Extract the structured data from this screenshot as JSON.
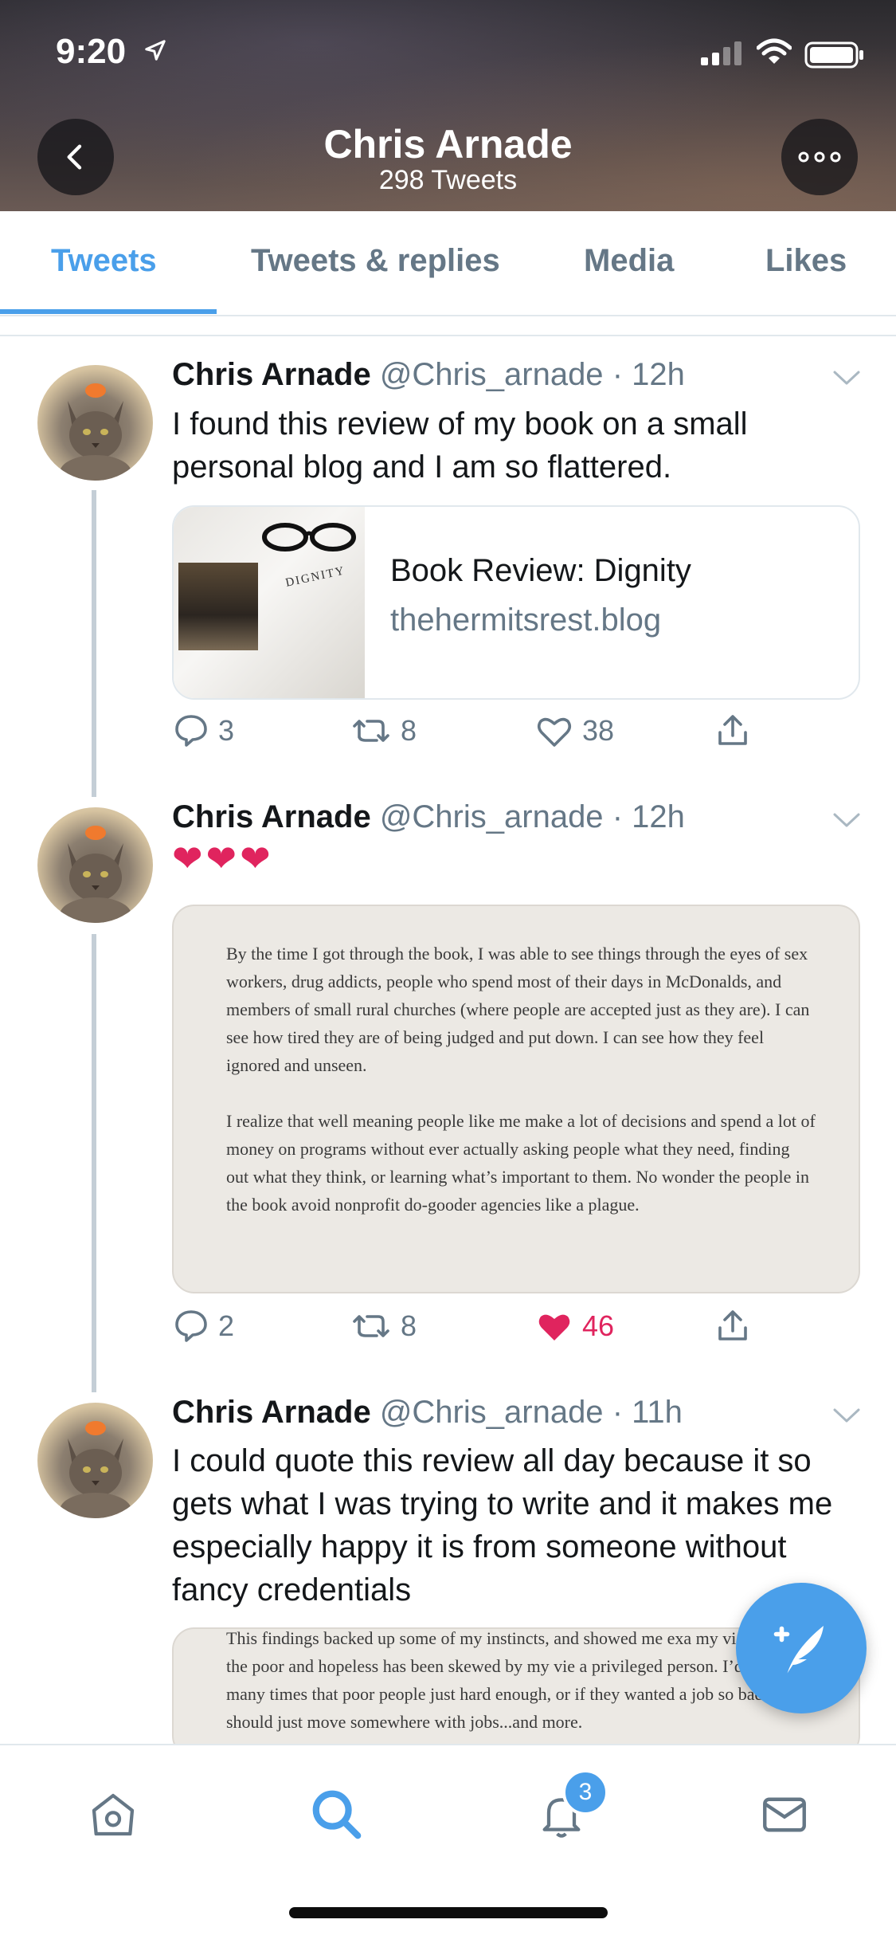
{
  "status_bar": {
    "time": "9:20"
  },
  "header": {
    "name": "Chris Arnade",
    "tweet_count": "298 Tweets"
  },
  "tabs": [
    {
      "label": "Tweets",
      "active": true
    },
    {
      "label": "Tweets & replies",
      "active": false
    },
    {
      "label": "Media",
      "active": false
    },
    {
      "label": "Likes",
      "active": false
    }
  ],
  "tweets": [
    {
      "name": "Chris Arnade",
      "handle": "@Chris_arnade",
      "time": "· 12h",
      "text": "I found this review of my book on a small personal blog and I am so flattered.",
      "card": {
        "title": "Book Review: Dignity",
        "domain": "thehermitsrest.blog",
        "thumb_text": "DIGNITY"
      },
      "replies": "3",
      "retweets": "8",
      "likes": "38",
      "liked": false
    },
    {
      "name": "Chris Arnade",
      "handle": "@Chris_arnade",
      "time": "· 12h",
      "hearts": "❤❤❤",
      "quote_paragraphs": [
        "By the time I got through the book, I was able to see things through the eyes of sex workers, drug addicts, people who spend most of their days in McDonalds, and members of small rural churches (where people are accepted just as they are). I can see how tired they are of being judged and put down. I can see how they feel ignored and unseen.",
        "I realize that well meaning people like me make a lot of decisions and spend a lot of money on programs without ever actually asking people what they need, finding out what they think, or learning what’s important to them. No wonder the people in the book avoid nonprofit do-gooder agencies like a plague."
      ],
      "replies": "2",
      "retweets": "8",
      "likes": "46",
      "liked": true
    },
    {
      "name": "Chris Arnade",
      "handle": "@Chris_arnade",
      "time": "· 11h",
      "text": "I could quote this review all day because it so gets what I was trying to write and it makes me especially happy it is from someone without fancy credentials",
      "quote_excerpt": "This findings backed up some of my instincts, and showed me exa my viewpoint of the poor and hopeless has been skewed by my vie a privileged person. I’d heard too many times that poor people just hard enough, or if they wanted a job so badly, they should just move somewhere with jobs...and more."
    }
  ],
  "bottom_nav": {
    "notifications_badge": "3"
  },
  "colors": {
    "accent": "#4a9fea",
    "like": "#e0245e",
    "muted": "#657786"
  }
}
